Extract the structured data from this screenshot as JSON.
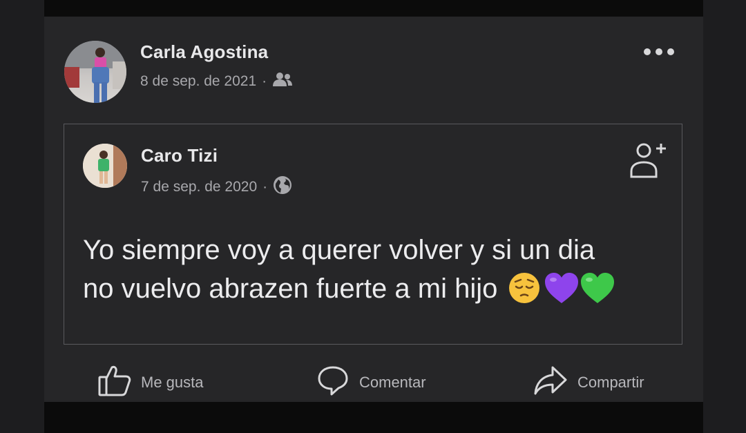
{
  "post": {
    "author": "Carla Agostina",
    "date": "8 de sep. de 2021",
    "audience_icon": "friends-icon",
    "more_icon": "more-options-icon"
  },
  "shared_post": {
    "author": "Caro Tizi",
    "date": "7 de sep. de 2020",
    "audience_icon": "globe-icon",
    "follow_icon": "add-friend-icon",
    "text_line1": "Yo siempre voy a querer volver y si un dia",
    "text_line2": "no vuelvo abrazen fuerte a mi hijo",
    "emojis": [
      "pensive-face-emoji",
      "purple-heart-emoji",
      "green-heart-emoji"
    ]
  },
  "actions": {
    "like_label": "Me gusta",
    "comment_label": "Comentar",
    "share_label": "Compartir"
  },
  "colors": {
    "background": "#262628",
    "text_primary": "#e8e8ea",
    "text_secondary": "#a8a8ac",
    "purple_heart": "#8e44ec",
    "green_heart": "#3ec84a"
  }
}
